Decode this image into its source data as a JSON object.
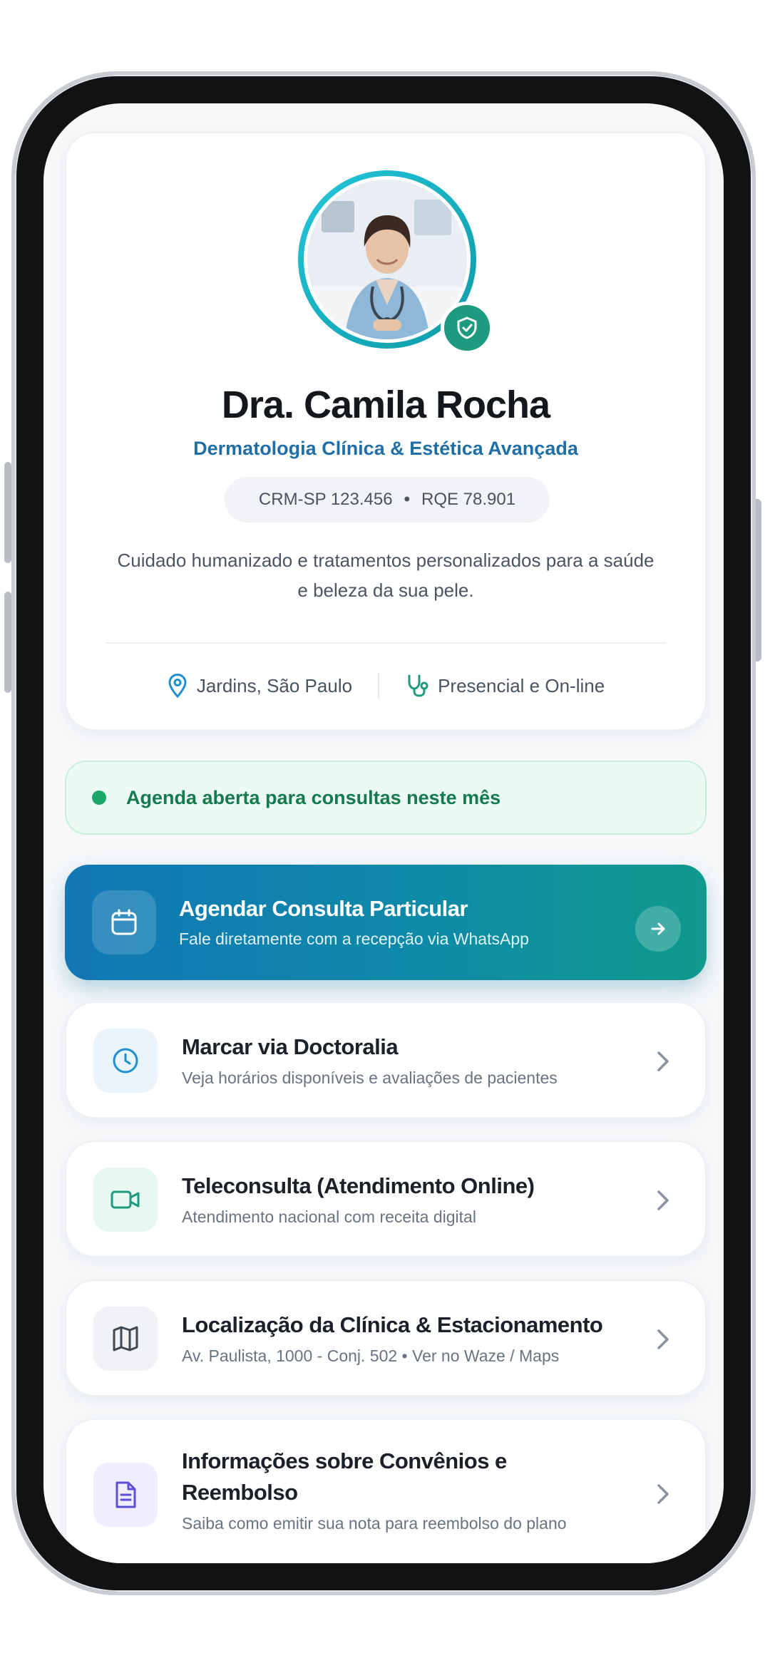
{
  "profile": {
    "name": "Dra. Camila Rocha",
    "specialty": "Dermatologia Clínica & Estética Avançada",
    "crm": "CRM-SP 123.456",
    "rqe": "RQE 78.901",
    "bio": "Cuidado humanizado e tratamentos personalizados para a saúde e beleza da sua pele.",
    "location": "Jardins, São Paulo",
    "modality": "Presencial e On-line"
  },
  "status": {
    "text": "Agenda aberta para consultas neste mês",
    "color": "#1aa86a"
  },
  "cta": {
    "title": "Agendar Consulta Particular",
    "subtitle": "Fale diretamente com a recepção via WhatsApp"
  },
  "options": [
    {
      "title": "Marcar via Doctoralia",
      "subtitle": "Veja horários disponíveis e avaliações de pacientes",
      "icon": "clock-icon"
    },
    {
      "title": "Teleconsulta (Atendimento Online)",
      "subtitle": "Atendimento nacional com receita digital",
      "icon": "video-camera-icon"
    },
    {
      "title": "Localização da Clínica & Estacionamento",
      "subtitle": "Av. Paulista, 1000 - Conj. 502 • Ver no Waze / Maps",
      "icon": "map-icon"
    },
    {
      "title_line1": "Informações sobre Convênios e",
      "title_line2": "Reembolso",
      "subtitle": "Saiba como emitir sua nota para reembolso do plano",
      "icon": "document-icon"
    }
  ],
  "colors": {
    "accent": "#1177b5",
    "teal": "#0f9a8c",
    "verified": "#1e9a7e"
  }
}
